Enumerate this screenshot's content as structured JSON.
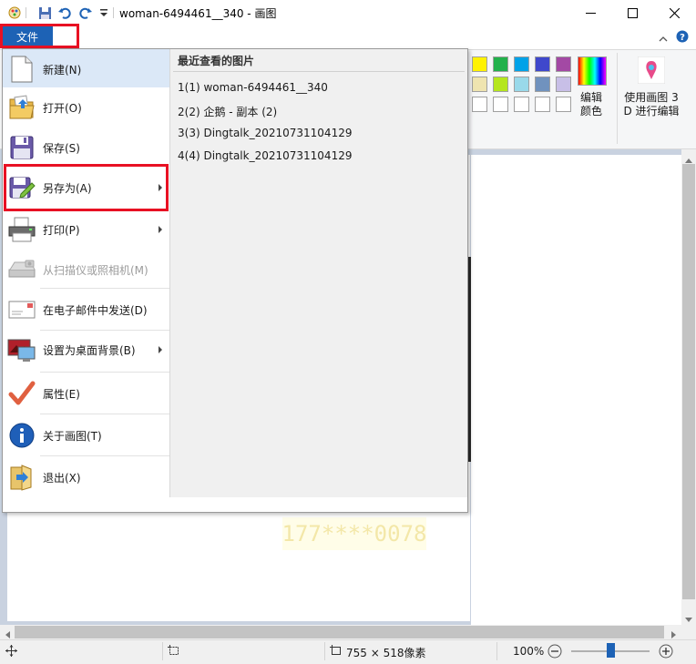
{
  "window": {
    "title": "woman-6494461__340 - 画图",
    "accent": "#1d62b5"
  },
  "ribbon": {
    "file_tab": "文件",
    "edit_colors_line1": "编辑",
    "edit_colors_line2": "颜色",
    "paint3d_line1": "使用画图 3",
    "paint3d_line2": "D 进行编辑",
    "palette_row1": [
      "#fff200",
      "#22b14c",
      "#00a2e8",
      "#3f48cc",
      "#a349a4"
    ],
    "palette_row2": [
      "#efe4b0",
      "#b5e61d",
      "#99d9ea",
      "#7092be",
      "#c8bfe7"
    ]
  },
  "file_menu": {
    "items": [
      {
        "label": "新建(N)",
        "icon": "new-file-icon",
        "submenu": false,
        "enabled": true
      },
      {
        "label": "打开(O)",
        "icon": "open-folder-icon",
        "submenu": false,
        "enabled": true
      },
      {
        "label": "保存(S)",
        "icon": "save-disk-icon",
        "submenu": false,
        "enabled": true
      },
      {
        "label": "另存为(A)",
        "icon": "save-as-icon",
        "submenu": true,
        "enabled": true
      },
      {
        "label": "打印(P)",
        "icon": "printer-icon",
        "submenu": true,
        "enabled": true
      },
      {
        "label": "从扫描仪或照相机(M)",
        "icon": "scanner-icon",
        "submenu": false,
        "enabled": false
      },
      {
        "label": "在电子邮件中发送(D)",
        "icon": "email-icon",
        "submenu": false,
        "enabled": true
      },
      {
        "label": "设置为桌面背景(B)",
        "icon": "desktop-background-icon",
        "submenu": true,
        "enabled": true
      },
      {
        "label": "属性(E)",
        "icon": "checkmark-icon",
        "submenu": false,
        "enabled": true
      },
      {
        "label": "关于画图(T)",
        "icon": "info-icon",
        "submenu": false,
        "enabled": true
      },
      {
        "label": "退出(X)",
        "icon": "exit-icon",
        "submenu": false,
        "enabled": true
      }
    ],
    "recent_header": "最近查看的图片",
    "recent": [
      "1(1)  woman-6494461__340",
      "2(2)  企鹅 - 副本 (2)",
      "3(3)  Dingtalk_20210731104129",
      "4(4)  Dingtalk_20210731104129"
    ]
  },
  "statusbar": {
    "dimensions": "755 × 518像素",
    "zoom": "100%",
    "zoom_level_fraction": 0.5
  },
  "canvas": {
    "ghost_text": "177****0078"
  }
}
